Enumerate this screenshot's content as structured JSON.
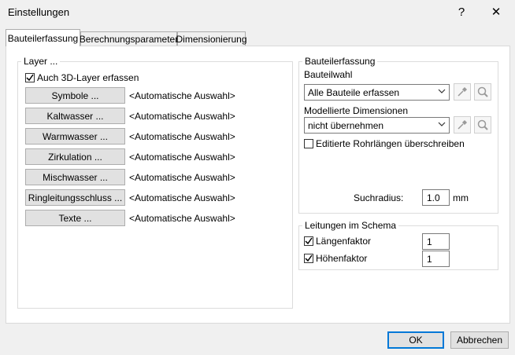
{
  "window": {
    "title": "Einstellungen",
    "help_label": "?",
    "close_label": "✕"
  },
  "tabs": [
    {
      "label": "Bauteilerfassung"
    },
    {
      "label": "Berechnungsparameter"
    },
    {
      "label": "Dimensionierung"
    }
  ],
  "layer_group": {
    "legend": "Layer ...",
    "include_3d_label": "Auch 3D-Layer erfassen",
    "include_3d_checked": true,
    "rows": [
      {
        "button": "Symbole ...",
        "value": "<Automatische Auswahl>"
      },
      {
        "button": "Kaltwasser ...",
        "value": "<Automatische Auswahl>"
      },
      {
        "button": "Warmwasser ...",
        "value": "<Automatische Auswahl>"
      },
      {
        "button": "Zirkulation ...",
        "value": "<Automatische Auswahl>"
      },
      {
        "button": "Mischwasser ...",
        "value": "<Automatische Auswahl>"
      },
      {
        "button": "Ringleitungsschluss ...",
        "value": "<Automatische Auswahl>"
      },
      {
        "button": "Texte ...",
        "value": "<Automatische Auswahl>"
      }
    ]
  },
  "bauteil_group": {
    "legend": "Bauteilerfassung",
    "bauteilwahl_label": "Bauteilwahl",
    "bauteilwahl_value": "Alle Bauteile erfassen",
    "dimensions_label": "Modellierte Dimensionen",
    "dimensions_value": "nicht übernehmen",
    "edited_lengths_label": "Editierte Rohrlängen überschreiben",
    "edited_lengths_checked": false,
    "search_radius_label": "Suchradius:",
    "search_radius_value": "1.0",
    "search_radius_unit": "mm",
    "icons": {
      "pick": "eyedropper-icon",
      "find": "magnifier-icon"
    }
  },
  "schema_group": {
    "legend": "Leitungen im Schema",
    "length_factor_label": "Längenfaktor",
    "length_factor_checked": true,
    "length_factor_value": "1",
    "height_factor_label": "Höhenfaktor",
    "height_factor_checked": true,
    "height_factor_value": "1"
  },
  "footer": {
    "ok_label": "OK",
    "cancel_label": "Abbrechen"
  },
  "colors": {
    "accent": "#0078d7",
    "background": "#f0f0f0",
    "panel": "#ffffff"
  }
}
